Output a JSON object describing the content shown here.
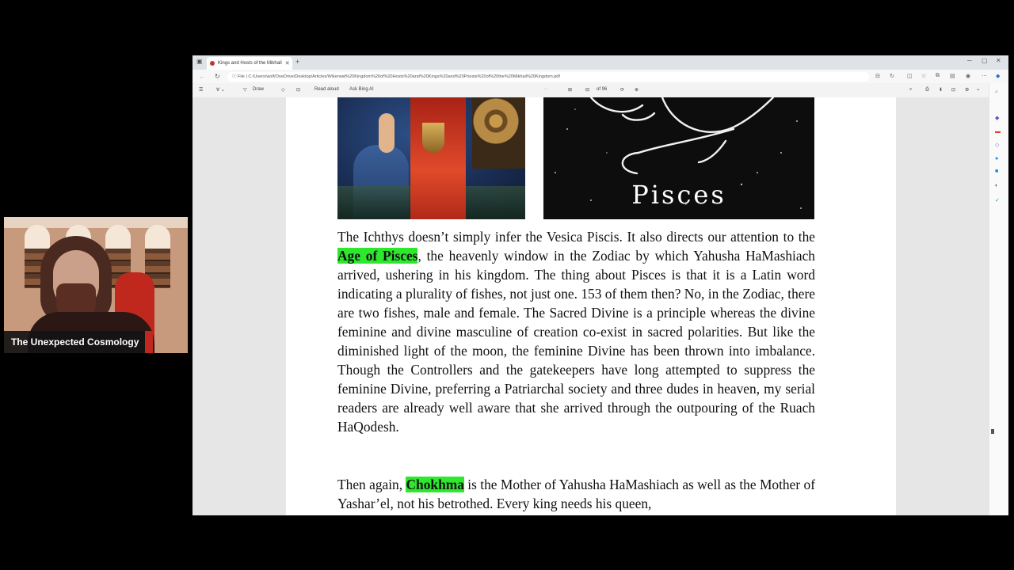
{
  "browser": {
    "tab_title": "Kings and Hosts of the Mikhail",
    "url": "C:/Users/wolf/OneDrive/Desktop/Articles/Wikerwat%20Kingdom%20of%20Hosts%20and%20Kings%20and%20Priests%20of%20the%20Mikhail%20Kingdom.pdf",
    "file_label": "File",
    "tools": {
      "draw_label": "Draw",
      "read_aloud_label": "Read aloud",
      "ask_label": "Ask Bing AI"
    },
    "page_indicator": "of 96"
  },
  "document": {
    "image_caption": "Pisces",
    "para1": {
      "line1": "The Ichthys doesn’t simply infer the Vesica Piscis. It also directs our",
      "pre": "attention to the ",
      "highlight": "Age of Pisces",
      "post": ", the heavenly window in the Zodiac by which Yahusha HaMashiach arrived, ushering in his kingdom. The thing about Pisces is that it is a Latin word indicating a plurality of fishes, not just one. 153 of them then? No, in the Zodiac, there are two fishes, male and female. The Sacred Divine is a principle whereas the divine feminine and divine masculine of creation co-exist in sacred polarities. But like the diminished light of the moon, the feminine Divine has been thrown into imbalance. Though the Controllers and the gatekeepers have long attempted to suppress the feminine Divine, preferring a Patriarchal society and three dudes in heaven, my serial readers are already well aware that she arrived through the outpouring of the Ruach HaQodesh."
    },
    "para2": {
      "pre": "Then again, ",
      "highlight": "Chokhma",
      "post": " is the Mother of Yahusha HaMashiach as well as the Mother of Yashar’el, not his betrothed. Every king needs his queen,"
    },
    "highlight_color": "#2ee82e"
  },
  "webcam": {
    "label": "The Unexpected Cosmology",
    "accent_color": "#c0281e"
  }
}
